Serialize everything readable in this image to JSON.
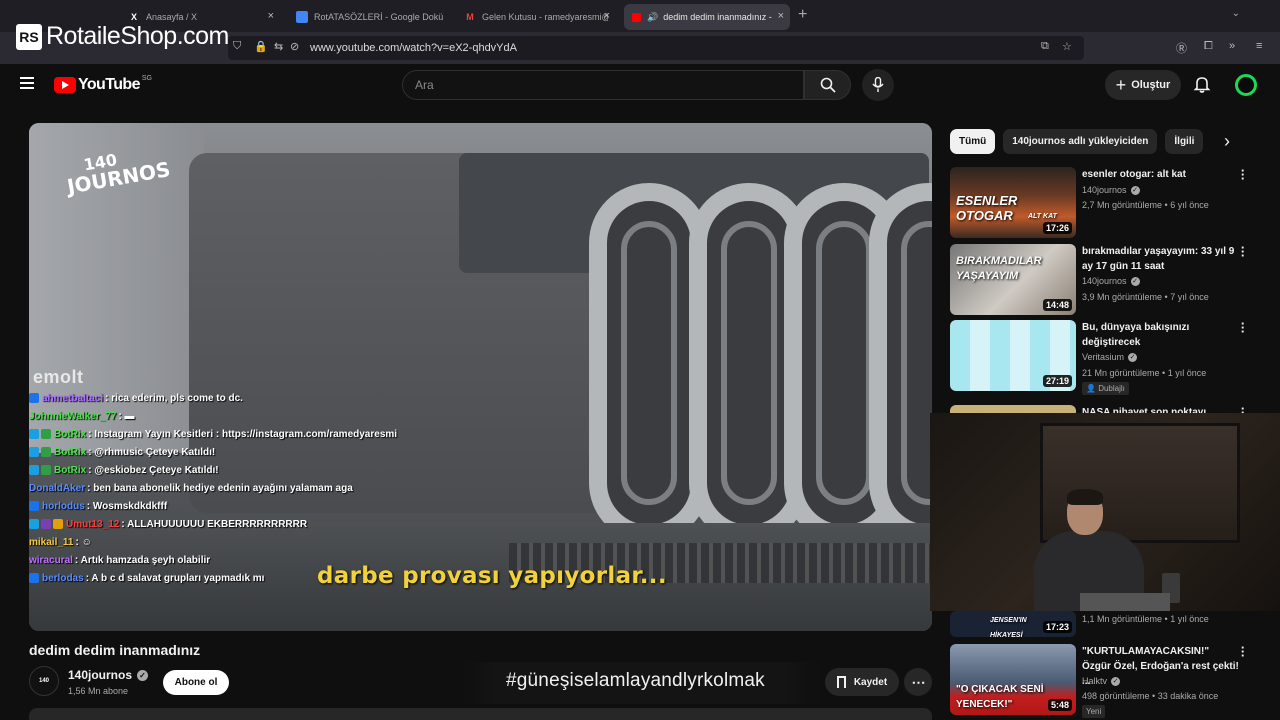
{
  "watermark": {
    "logo": "RS",
    "text": "RotaileShop.com"
  },
  "browser": {
    "tabs": [
      {
        "label": "Anasayfa / X",
        "icon": "x-icon"
      },
      {
        "label": "RotATASÖZLERİ - Google Dokü",
        "icon": "google-docs-icon"
      },
      {
        "label": "Gelen Kutusu - ramedyaresmi@",
        "icon": "gmail-icon"
      },
      {
        "label": "dedim dedim inanmadınız -",
        "icon": "youtube-icon",
        "active": true
      }
    ],
    "url": "www.youtube.com/watch?v=eX2-qhdvYdA"
  },
  "youtube": {
    "logo_text": "YouTube",
    "country": "SG",
    "search_placeholder": "Ara",
    "create_label": "Oluştur"
  },
  "video": {
    "channel_watermark_line1": "140",
    "channel_watermark_line2": "JOURNOS",
    "stream_watermark": "emolt",
    "subtitle": "darbe provası yapıyorlar...",
    "title": "dedim dedim inanmadınız",
    "channel": "140journos",
    "subscribers": "1,56 Mn abone",
    "subscribe_label": "Abone ol",
    "save_label": "Kaydet",
    "hashtag": "#güneşiselamlayandlyrkolmak"
  },
  "chat": [
    {
      "user": "ahmetbaltaci",
      "color": "#a970ff",
      "text": ": rica ederim, pls come to dc.",
      "badges": [
        "#1a73e8"
      ]
    },
    {
      "user": "JohnnieWalker_77",
      "color": "#4ce04c",
      "text": ": ▬",
      "badges": []
    },
    {
      "user": "BotRix",
      "color": "#4ce04c",
      "text": ": Instagram Yayın Kesitleri : https://instagram.com/ramedyaresmi",
      "badges": [
        "#1a9fe0",
        "#2ea043"
      ]
    },
    {
      "user": "BotRix",
      "color": "#4ce04c",
      "text": ": @rhmusic Çeteye Katıldı!",
      "badges": [
        "#1a9fe0",
        "#2ea043"
      ]
    },
    {
      "user": "BotRix",
      "color": "#4ce04c",
      "text": ": @eskiobez Çeteye Katıldı!",
      "badges": [
        "#1a9fe0",
        "#2ea043"
      ]
    },
    {
      "user": "DonaldAker",
      "color": "#5b8cff",
      "text": ": ben bana abonelik hediye edenin ayağını yalamam aga",
      "badges": []
    },
    {
      "user": "horlodus",
      "color": "#5b8cff",
      "text": ": Wosmskdkdkfff",
      "badges": [
        "#1a73e8"
      ]
    },
    {
      "user": "Umut13_12",
      "color": "#ff3b3b",
      "text": ": ALLAHUUUUUU EKBERRRRRRRRRR",
      "badges": [
        "#1a9fe0",
        "#7a3fb0",
        "#e3a008"
      ]
    },
    {
      "user": "mikail_11",
      "color": "#f2c744",
      "text": ": ☺",
      "badges": []
    },
    {
      "user": "wiracural",
      "color": "#c070ff",
      "text": ": Artık hamzada şeyh olabilir",
      "badges": []
    },
    {
      "user": "berlodas",
      "color": "#5b8cff",
      "text": ": A b c d salavat grupları yapmadık mı",
      "badges": [
        "#1a73e8"
      ]
    }
  ],
  "sidebar": {
    "chips": [
      "Tümü",
      "140journos adlı yükleyiciden",
      "İlgili"
    ],
    "recommendations": [
      {
        "title": "esenler otogar: alt kat",
        "channel": "140journos",
        "verified": true,
        "meta": "2,7 Mn görüntüleme • 6 yıl önce",
        "duration": "17:26",
        "thumb_text": "ESENLER OTOGAR",
        "thumb_sub": "ALT KAT"
      },
      {
        "title": "bırakmadılar yaşayayım: 33 yıl 9 ay 17 gün 11 saat",
        "channel": "140journos",
        "verified": true,
        "meta": "3,9 Mn görüntüleme • 7 yıl önce",
        "duration": "14:48",
        "thumb_text": "BIRAKMADILAR YAŞAYAYIM"
      },
      {
        "title": "Bu, dünyaya bakışınızı değiştirecek",
        "channel": "Veritasium",
        "verified": true,
        "meta": "21 Mn görüntüleme • 1 yıl önce",
        "duration": "27:19",
        "badge": "Dublajlı"
      },
      {
        "title": "NASA nihayet son noktayı",
        "partial": true
      },
      {
        "title": "",
        "channel": "",
        "meta": "1,1 Mn görüntüleme • 1 yıl önce",
        "duration": "17:23",
        "thumb_text": "JENSEN'IN HİKAYESİ"
      },
      {
        "title": "\"KURTULAMAYACAKSIN!\" Özgür Özel, Erdoğan'a rest çekti! ...",
        "channel": "Halktv",
        "verified": true,
        "meta": "498 görüntüleme • 33 dakika önce",
        "duration": "5:48",
        "badge": "Yeni",
        "thumb_text": "\"O ÇIKACAK SENİ YENECEK!\""
      }
    ]
  },
  "colors": {
    "accent": "#ff0000",
    "bg": "#0f0f0f",
    "subtitle": "#f2d23a"
  }
}
